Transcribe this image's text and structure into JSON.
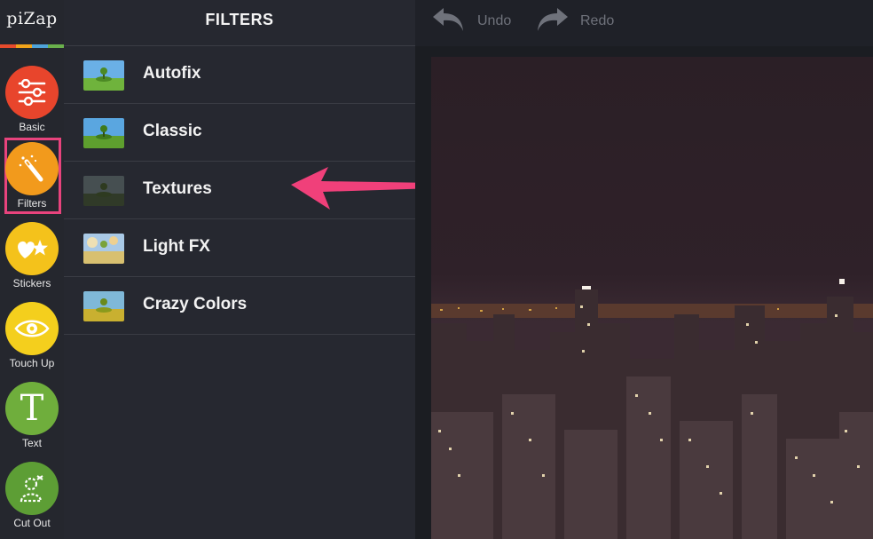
{
  "app": {
    "logo": "piZap",
    "logo_bar_colors": [
      "#e64b2c",
      "#f1a31a",
      "#4fa3d9",
      "#6ab04c"
    ]
  },
  "tools": [
    {
      "label": "Basic",
      "color": "#e8452c",
      "icon": "sliders-icon"
    },
    {
      "label": "Filters",
      "color": "#f29a1c",
      "icon": "magic-wand-icon",
      "selected": true
    },
    {
      "label": "Stickers",
      "color": "#f4c21b",
      "icon": "stickers-icon"
    },
    {
      "label": "Touch Up",
      "color": "#f4cf1d",
      "icon": "eye-icon"
    },
    {
      "label": "Text",
      "color": "#6fae3c",
      "icon": "text-t-icon"
    },
    {
      "label": "Cut Out",
      "color": "#5d9e35",
      "icon": "cutout-icon"
    }
  ],
  "panel": {
    "title": "FILTERS",
    "items": [
      {
        "label": "Autofix"
      },
      {
        "label": "Classic"
      },
      {
        "label": "Textures"
      },
      {
        "label": "Light FX"
      },
      {
        "label": "Crazy Colors"
      }
    ]
  },
  "toolbar": {
    "undo_label": "Undo",
    "redo_label": "Redo"
  },
  "colors": {
    "highlight": "#e8437d",
    "arrow": "#f0407a"
  }
}
